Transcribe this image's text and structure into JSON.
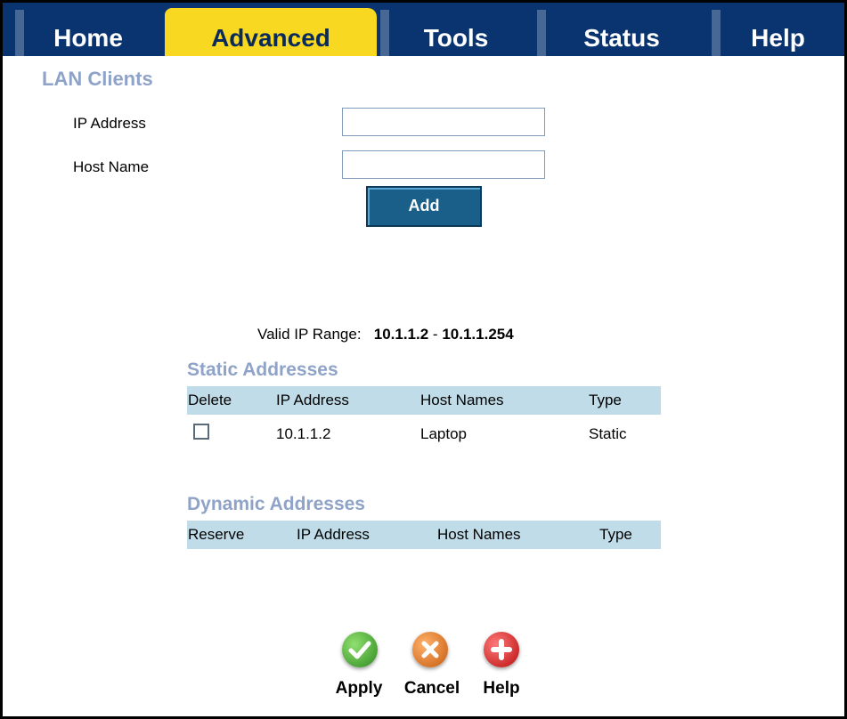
{
  "tabs": [
    "Home",
    "Advanced",
    "Tools",
    "Status",
    "Help"
  ],
  "active_tab": "Advanced",
  "lan_clients": {
    "title": "LAN Clients",
    "ip_label": "IP Address",
    "ip_value": "",
    "host_label": "Host Name",
    "host_value": "",
    "add_button": "Add"
  },
  "valid_range": {
    "label": "Valid IP Range:",
    "start": "10.1.1.2",
    "separator": "-",
    "end": "10.1.1.254"
  },
  "static": {
    "title": "Static Addresses",
    "headers": [
      "Delete",
      "IP Address",
      "Host Names",
      "Type"
    ],
    "rows": [
      {
        "ip": "10.1.1.2",
        "host": "Laptop",
        "type": "Static"
      }
    ]
  },
  "dynamic": {
    "title": "Dynamic Addresses",
    "headers": [
      "Reserve",
      "IP Address",
      "Host Names",
      "Type"
    ]
  },
  "actions": {
    "apply": "Apply",
    "cancel": "Cancel",
    "help": "Help"
  },
  "colors": {
    "tab_bar": "#0a3470",
    "active_tab": "#f8d820",
    "section_title": "#8fa3c8",
    "table_header": "#bfdce8"
  }
}
